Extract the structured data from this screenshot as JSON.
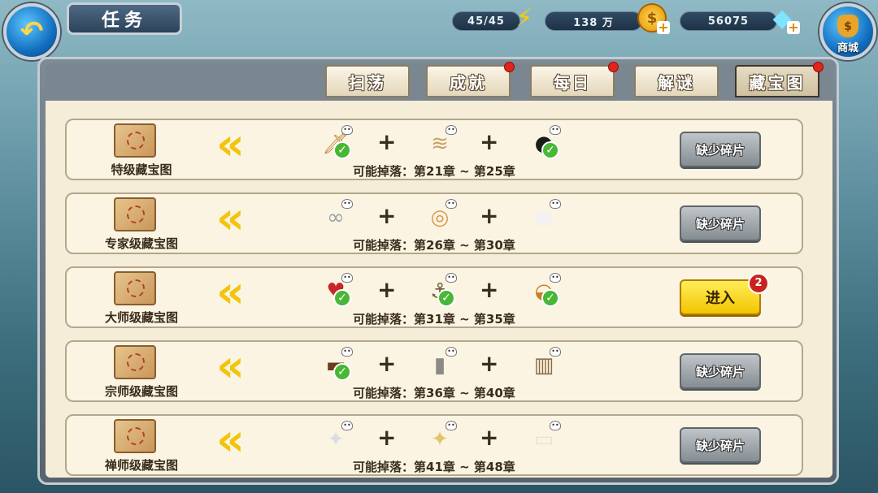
{
  "header": {
    "title": "任务",
    "back_icon": "arrow-back-icon",
    "stamina": "45/45",
    "gold": "138 万",
    "diamonds": "56075",
    "shop_label": "商城"
  },
  "tabs": [
    {
      "label": "扫荡",
      "has_dot": false,
      "active": false
    },
    {
      "label": "成就",
      "has_dot": true,
      "active": false
    },
    {
      "label": "每日",
      "has_dot": true,
      "active": false
    },
    {
      "label": "解谜",
      "has_dot": false,
      "active": false
    },
    {
      "label": "藏宝图",
      "has_dot": true,
      "active": true
    }
  ],
  "rows": [
    {
      "name": "特级藏宝图",
      "drop": "可能掉落：第21章 ~ 第25章",
      "button": "缺少碎片",
      "button_style": "gray",
      "badge": "",
      "items": [
        {
          "icon": "dagger-icon",
          "checked": true
        },
        {
          "icon": "bandana-icon",
          "checked": false
        },
        {
          "icon": "bomb-icon",
          "checked": true
        }
      ]
    },
    {
      "name": "专家级藏宝图",
      "drop": "可能掉落：第26章 ~ 第30章",
      "button": "缺少碎片",
      "button_style": "gray",
      "badge": "",
      "items": [
        {
          "icon": "chain-icon",
          "checked": false
        },
        {
          "icon": "ring-icon",
          "checked": false
        },
        {
          "icon": "pearl-icon",
          "checked": false
        }
      ]
    },
    {
      "name": "大师级藏宝图",
      "drop": "可能掉落：第31章 ~ 第35章",
      "button": "进入",
      "button_style": "yellow",
      "badge": "2",
      "items": [
        {
          "icon": "card-icon",
          "checked": true
        },
        {
          "icon": "anchor-icon",
          "checked": true
        },
        {
          "icon": "bread-icon",
          "checked": true
        }
      ]
    },
    {
      "name": "宗师级藏宝图",
      "drop": "可能掉落：第36章 ~ 第40章",
      "button": "缺少碎片",
      "button_style": "gray",
      "badge": "",
      "items": [
        {
          "icon": "cigar-icon",
          "checked": true
        },
        {
          "icon": "bottle-icon",
          "checked": false
        },
        {
          "icon": "barrel-icon",
          "checked": false
        }
      ]
    },
    {
      "name": "禅师级藏宝图",
      "drop": "可能掉落：第41章 ~ 第48章",
      "button": "缺少碎片",
      "button_style": "gray",
      "badge": "",
      "items": [
        {
          "icon": "silver-ore-icon",
          "checked": false
        },
        {
          "icon": "gold-ore-icon",
          "checked": false
        },
        {
          "icon": "bandage-icon",
          "checked": false
        }
      ]
    }
  ]
}
